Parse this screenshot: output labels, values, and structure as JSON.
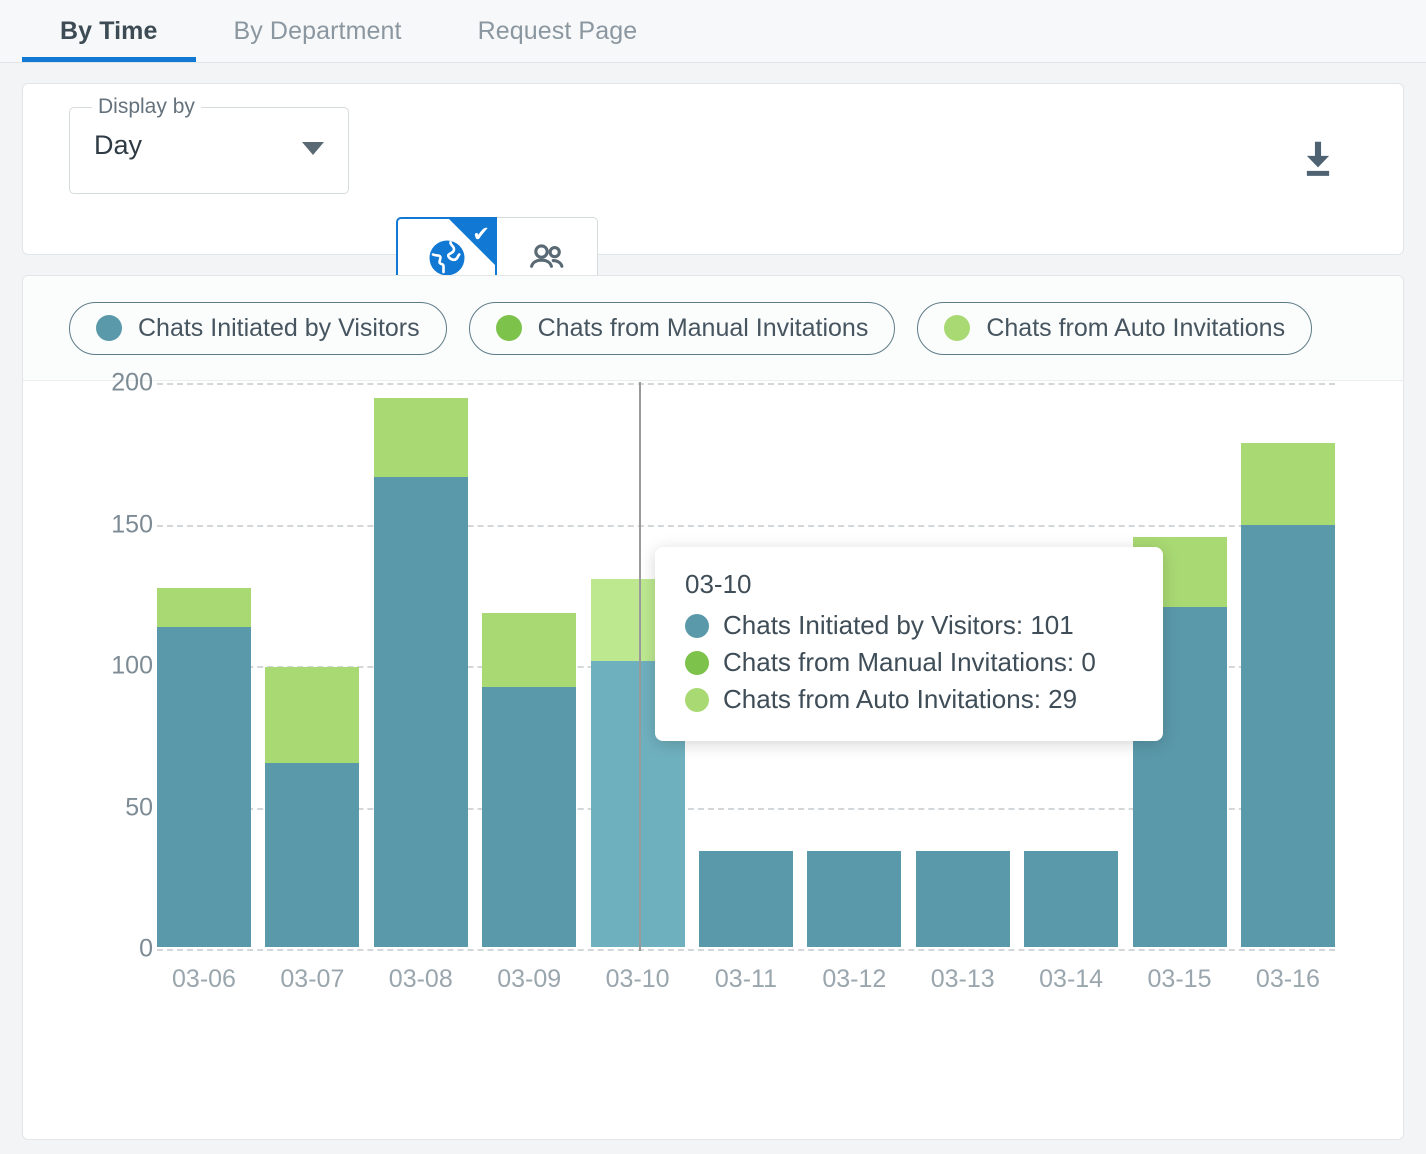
{
  "tabs": [
    {
      "label": "By Time",
      "active": true
    },
    {
      "label": "By Department",
      "active": false
    },
    {
      "label": "Request Page",
      "active": false
    }
  ],
  "toolbar": {
    "display_by_label": "Display by",
    "display_by_value": "Day",
    "display_by_options": [
      "Day"
    ],
    "caret_icon": "chevron-down-icon",
    "toggle": [
      {
        "icon": "globe-icon",
        "selected": true,
        "check_glyph": "✔"
      },
      {
        "icon": "people-icon",
        "selected": false
      }
    ],
    "download_icon": "download-icon"
  },
  "legend": [
    {
      "label": "Chats Initiated by Visitors",
      "color": "#5a99aa"
    },
    {
      "label": "Chats from Manual Invitations",
      "color": "#7dc24b"
    },
    {
      "label": "Chats from Auto Invitations",
      "color": "#a9d973"
    }
  ],
  "tooltip": {
    "title": "03-10",
    "rows": [
      {
        "label": "Chats Initiated by Visitors: 101",
        "color": "#5a99aa"
      },
      {
        "label": "Chats from Manual Invitations: 0",
        "color": "#7dc24b"
      },
      {
        "label": "Chats from Auto Invitations: 29",
        "color": "#a9d973"
      }
    ]
  },
  "chart_data": {
    "type": "bar",
    "stacked": true,
    "title": "",
    "xlabel": "",
    "ylabel": "",
    "ylim": [
      0,
      200
    ],
    "yticks": [
      0,
      50,
      100,
      150,
      200
    ],
    "ytick_labels": [
      "0",
      "50",
      "100",
      "150",
      "200"
    ],
    "grid": true,
    "legend_position": "top-left",
    "categories": [
      "03-06",
      "03-07",
      "03-08",
      "03-09",
      "03-10",
      "03-11",
      "03-12",
      "03-13",
      "03-14",
      "03-15",
      "03-16"
    ],
    "series": [
      {
        "name": "Chats Initiated by Visitors",
        "color": "#5a99aa",
        "values": [
          113,
          65,
          166,
          92,
          101,
          34,
          34,
          34,
          34,
          120,
          149
        ]
      },
      {
        "name": "Chats from Manual Invitations",
        "color": "#7dc24b",
        "values": [
          0,
          0,
          0,
          0,
          0,
          0,
          0,
          0,
          0,
          0,
          0
        ]
      },
      {
        "name": "Chats from Auto Invitations",
        "color": "#a9d973",
        "values": [
          14,
          34,
          28,
          26,
          29,
          0,
          0,
          0,
          0,
          25,
          29
        ]
      }
    ],
    "highlighted_category": "03-10",
    "highlight_colors": {
      "visitors": "#6fb0bf",
      "auto": "#bde890"
    },
    "occluded_categories": [
      "03-11",
      "03-12",
      "03-13",
      "03-14"
    ]
  }
}
